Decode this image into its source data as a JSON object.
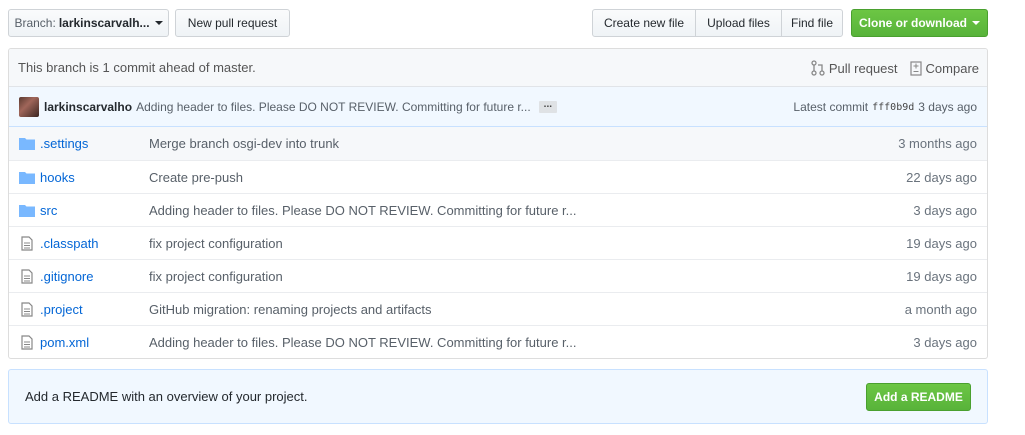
{
  "toolbar": {
    "branch_label": "Branch:",
    "branch_name": "larkinscarvalh...",
    "new_pr": "New pull request",
    "create_file": "Create new file",
    "upload_files": "Upload files",
    "find_file": "Find file",
    "clone": "Clone or download"
  },
  "tease": {
    "message": "This branch is 1 commit ahead of master.",
    "pull_request": "Pull request",
    "compare": "Compare"
  },
  "latest_commit": {
    "author": "larkinscarvalho",
    "message": "Adding header to files. Please DO NOT REVIEW. Committing for future r...",
    "ellipsis": "...",
    "label": "Latest commit",
    "sha": "fff0b9d",
    "age": "3 days ago"
  },
  "files": [
    {
      "type": "dir",
      "name": ".settings",
      "message": "Merge branch osgi-dev into trunk",
      "age": "3 months ago"
    },
    {
      "type": "dir",
      "name": "hooks",
      "message": "Create pre-push",
      "age": "22 days ago"
    },
    {
      "type": "dir",
      "name": "src",
      "message": "Adding header to files. Please DO NOT REVIEW. Committing for future r...",
      "age": "3 days ago"
    },
    {
      "type": "file",
      "name": ".classpath",
      "message": "fix project configuration",
      "age": "19 days ago"
    },
    {
      "type": "file",
      "name": ".gitignore",
      "message": "fix project configuration",
      "age": "19 days ago"
    },
    {
      "type": "file",
      "name": ".project",
      "message": "GitHub migration: renaming projects and artifacts",
      "age": "a month ago"
    },
    {
      "type": "file",
      "name": "pom.xml",
      "message": "Adding header to files. Please DO NOT REVIEW. Committing for future r...",
      "age": "3 days ago"
    }
  ],
  "readme": {
    "text": "Add a README with an overview of your project.",
    "button": "Add a README"
  },
  "colors": {
    "accent_green": "#6cc644",
    "link_blue": "#0366d6",
    "folder_blue": "#79b8ff"
  }
}
